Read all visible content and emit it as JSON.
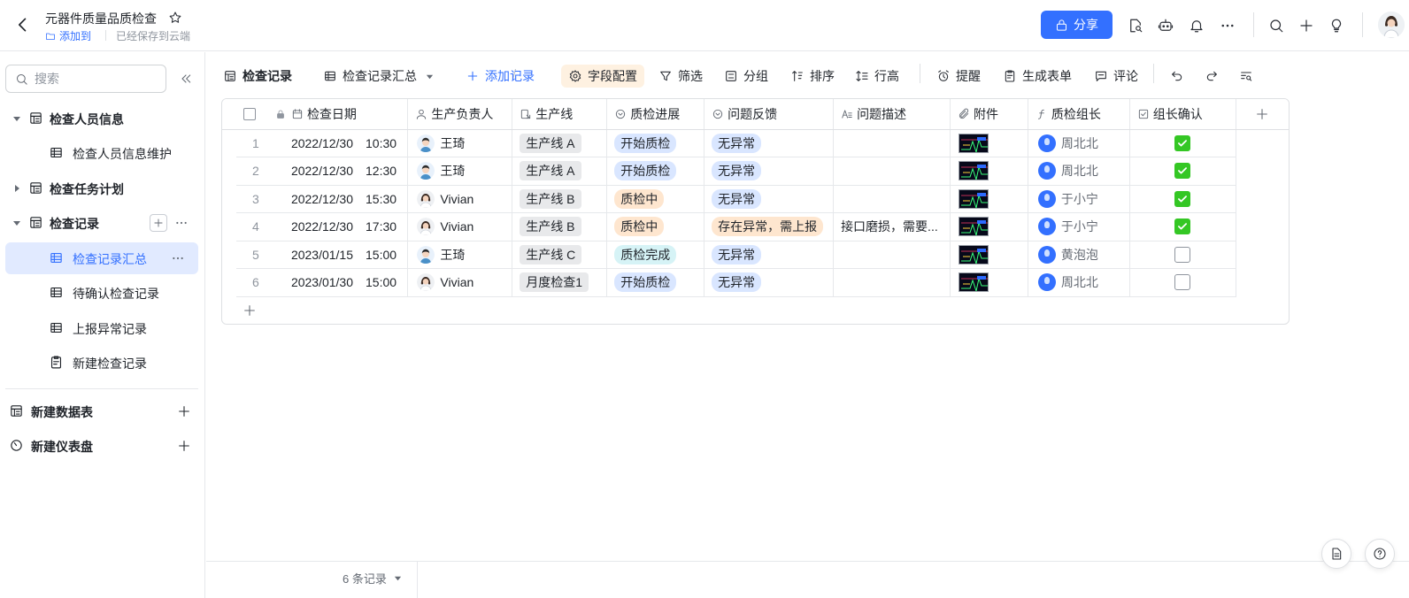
{
  "app": {
    "title": "元器件质量品质检查",
    "add_to_label": "添加到",
    "saved_status": "已经保存到云端",
    "share_label": "分享"
  },
  "sidebar": {
    "search_placeholder": "搜索",
    "items": [
      {
        "label": "检查人员信息",
        "level": 1,
        "expanded": true
      },
      {
        "label": "检查人员信息维护",
        "level": 2
      },
      {
        "label": "检查任务计划",
        "level": 1,
        "expanded": false
      },
      {
        "label": "检查记录",
        "level": 1,
        "expanded": true
      },
      {
        "label": "检查记录汇总",
        "level": 2,
        "active": true
      },
      {
        "label": "待确认检查记录",
        "level": 2
      },
      {
        "label": "上报异常记录",
        "level": 2
      },
      {
        "label": "新建检查记录",
        "level": 2
      }
    ],
    "new_table_label": "新建数据表",
    "new_dashboard_label": "新建仪表盘"
  },
  "toolbar": {
    "view_grid_label": "检查记录",
    "view_summary_label": "检查记录汇总",
    "add_record_label": "添加记录",
    "field_config_label": "字段配置",
    "filter_label": "筛选",
    "group_label": "分组",
    "sort_label": "排序",
    "row_height_label": "行高",
    "remind_label": "提醒",
    "generate_form_label": "生成表单",
    "comment_label": "评论"
  },
  "table": {
    "columns": [
      "检查日期",
      "生产负责人",
      "生产线",
      "质检进展",
      "问题反馈",
      "问题描述",
      "附件",
      "质检组长",
      "组长确认"
    ],
    "rows": [
      {
        "num": "1",
        "date": "2022/12/30",
        "time": "10:30",
        "owner": "王琦",
        "owner_avatar": "male",
        "line": "生产线 A",
        "progress": "开始质检",
        "progress_color": "blue",
        "feedback": "无异常",
        "feedback_color": "blue",
        "desc": "",
        "leader": "周北北",
        "confirmed": true
      },
      {
        "num": "2",
        "date": "2022/12/30",
        "time": "12:30",
        "owner": "王琦",
        "owner_avatar": "male",
        "line": "生产线 A",
        "progress": "开始质检",
        "progress_color": "blue",
        "feedback": "无异常",
        "feedback_color": "blue",
        "desc": "",
        "leader": "周北北",
        "confirmed": true
      },
      {
        "num": "3",
        "date": "2022/12/30",
        "time": "15:30",
        "owner": "Vivian",
        "owner_avatar": "female",
        "line": "生产线 B",
        "progress": "质检中",
        "progress_color": "orange",
        "feedback": "无异常",
        "feedback_color": "blue",
        "desc": "",
        "leader": "于小宁",
        "confirmed": true
      },
      {
        "num": "4",
        "date": "2022/12/30",
        "time": "17:30",
        "owner": "Vivian",
        "owner_avatar": "female",
        "line": "生产线 B",
        "progress": "质检中",
        "progress_color": "orange",
        "feedback": "存在异常，需上报",
        "feedback_color": "orange",
        "desc": "接口磨损，需要...",
        "leader": "于小宁",
        "confirmed": true
      },
      {
        "num": "5",
        "date": "2023/01/15",
        "time": "15:00",
        "owner": "王琦",
        "owner_avatar": "male",
        "line": "生产线 C",
        "progress": "质检完成",
        "progress_color": "teal",
        "feedback": "无异常",
        "feedback_color": "blue",
        "desc": "",
        "leader": "黄泡泡",
        "confirmed": false
      },
      {
        "num": "6",
        "date": "2023/01/30",
        "time": "15:00",
        "owner": "Vivian",
        "owner_avatar": "female",
        "line": "月度检查1",
        "progress": "开始质检",
        "progress_color": "blue",
        "feedback": "无异常",
        "feedback_color": "blue",
        "desc": "",
        "leader": "周北北",
        "confirmed": false
      }
    ]
  },
  "footer": {
    "record_count": "6 条记录"
  },
  "colors": {
    "accent": "#3370ff",
    "active_nav_bg": "#e1eaff",
    "check_green": "#34c724",
    "field_config_bg": "#fef1e1"
  }
}
